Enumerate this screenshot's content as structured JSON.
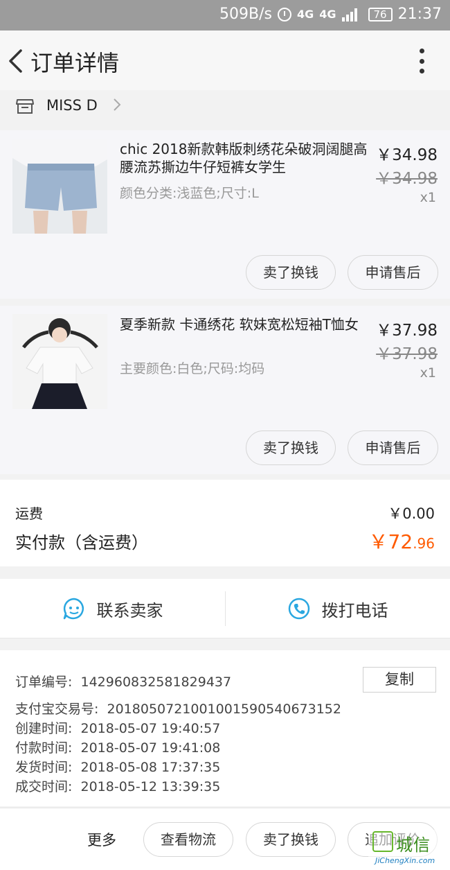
{
  "status_bar": {
    "speed": "509B/s",
    "network": "4G",
    "network2": "4G",
    "battery": "76",
    "time": "21:37"
  },
  "header": {
    "title": "订单详情"
  },
  "shop": {
    "name": "MISS  D"
  },
  "items": [
    {
      "name": "chic 2018新款韩版刺绣花朵破洞阔腿高腰流苏撕边牛仔短裤女学生",
      "sku": "颜色分类:浅蓝色;尺寸:L",
      "price": "￥34.98",
      "original_price": "￥34.98",
      "quantity": "x1",
      "buttons": [
        "卖了换钱",
        "申请售后"
      ]
    },
    {
      "name": "夏季新款 卡通绣花 软妹宽松短袖T恤女",
      "sku": "主要颜色:白色;尺码:均码",
      "price": "￥37.98",
      "original_price": "￥37.98",
      "quantity": "x1",
      "buttons": [
        "卖了换钱",
        "申请售后"
      ]
    }
  ],
  "totals": {
    "shipping_label": "运费",
    "shipping_value": "￥0.00",
    "paid_label": "实付款（含运费）",
    "paid_currency": "￥",
    "paid_integer": "72",
    "paid_decimal": ".96"
  },
  "contact": {
    "seller": "联系卖家",
    "phone": "拨打电话"
  },
  "order_info": {
    "copy_label": "复制",
    "rows": [
      {
        "label": "订单编号:",
        "value": "142960832581829437"
      },
      {
        "label": "支付宝交易号:",
        "value": "2018050721001001590540673152"
      },
      {
        "label": "创建时间:",
        "value": "2018-05-07 19:40:57"
      },
      {
        "label": "付款时间:",
        "value": "2018-05-07 19:41:08"
      },
      {
        "label": "发货时间:",
        "value": "2018-05-08 17:37:35"
      },
      {
        "label": "成交时间:",
        "value": "2018-05-12 13:39:35"
      }
    ]
  },
  "bottom_bar": {
    "more": "更多",
    "logistics": "查看物流",
    "resell": "卖了换钱",
    "review": "追加评价"
  },
  "watermark": {
    "cn": "城信",
    "en": "JiChengXin.com"
  },
  "colors": {
    "price_accent": "#ff5a00",
    "icon_blue": "#2aa7e0"
  }
}
